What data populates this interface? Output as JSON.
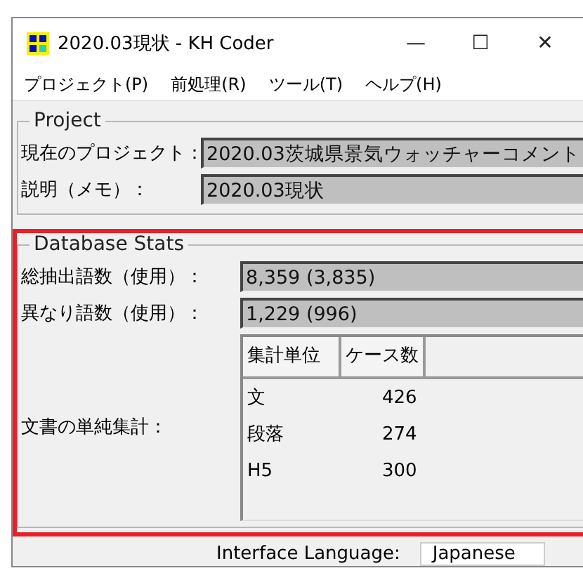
{
  "window": {
    "title": "2020.03現状 - KH Coder",
    "controls": [
      "—",
      "☐",
      "✕"
    ]
  },
  "menu": [
    {
      "label": "プロジェクト(P)"
    },
    {
      "label": "前処理(R)"
    },
    {
      "label": "ツール(T)"
    },
    {
      "label": "ヘルプ(H)"
    }
  ],
  "project": {
    "legend": "Project",
    "fields": [
      {
        "label": "現在のプロジェクト：",
        "value": "2020.03茨城県景気ウォッチャーコメント"
      },
      {
        "label": "説明（メモ）：",
        "value": "2020.03現状"
      }
    ]
  },
  "database_stats": {
    "legend": "Database Stats",
    "highlighted": true,
    "fields": [
      {
        "label": "総抽出語数（使用）：",
        "value": "8,359 (3,835)"
      },
      {
        "label": "異なり語数（使用）：",
        "value": "1,229 (996)"
      }
    ],
    "table_label": "文書の単純集計：",
    "table": {
      "columns": [
        "集計単位",
        "ケース数"
      ],
      "rows": [
        [
          "文",
          "426"
        ],
        [
          "段落",
          "274"
        ],
        [
          "H5",
          "300"
        ]
      ]
    }
  },
  "interface_language": {
    "label": "Interface Language:",
    "value": "Japanese"
  }
}
